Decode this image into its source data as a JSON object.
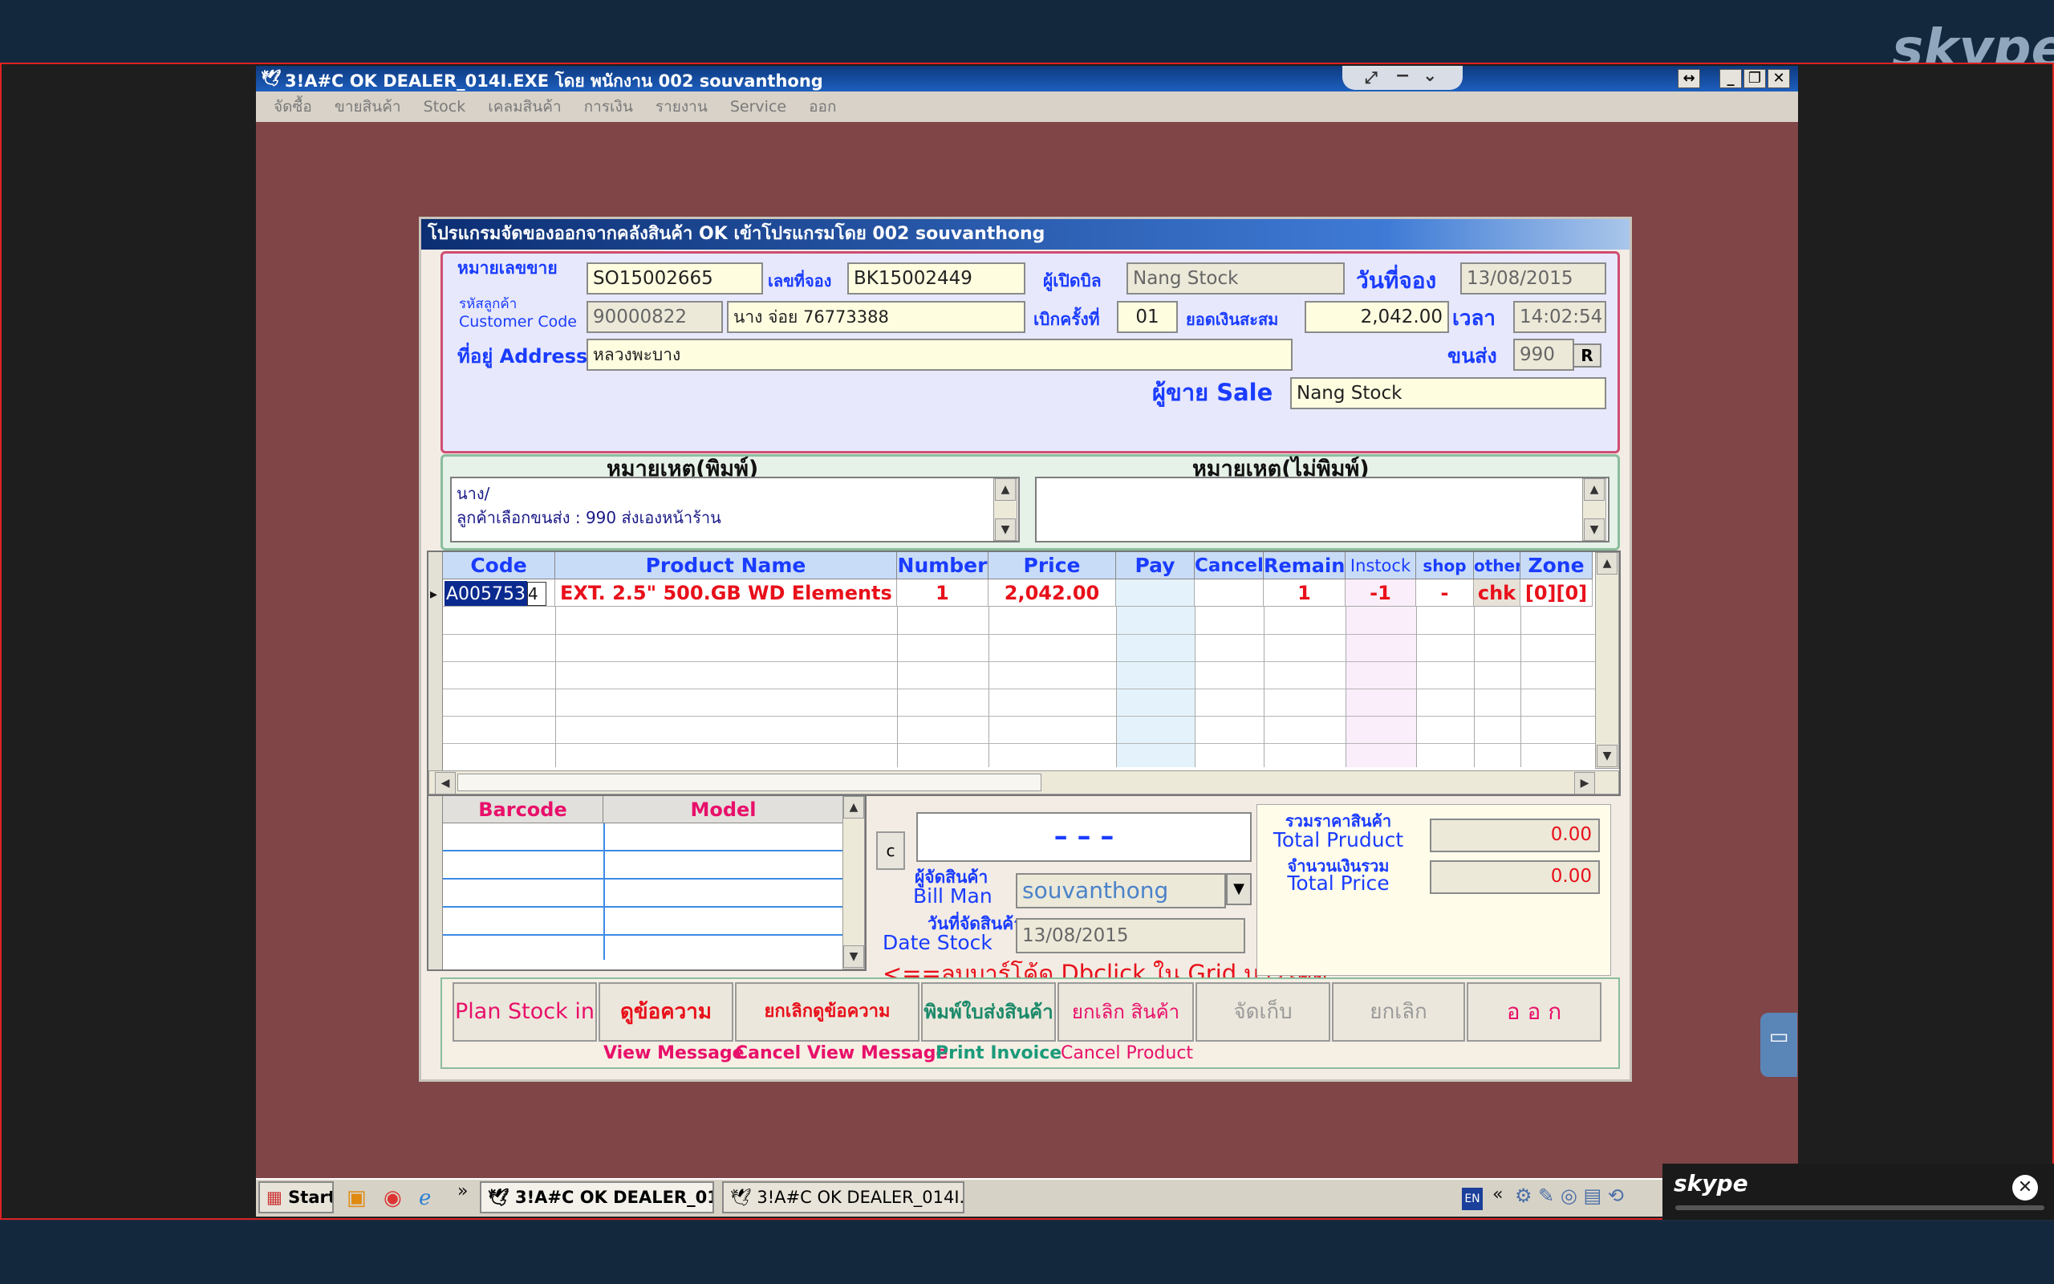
{
  "skype": {
    "logo": "skype",
    "mini_logo": "skype"
  },
  "window": {
    "title": "3!A#C OK DEALER_014I.EXE โดย พนักงาน 002 souvanthong",
    "menu": [
      "จัดซื้อ",
      "ขายสินค้า",
      "Stock",
      "เคลมสินค้า",
      "การเงิน",
      "รายงาน",
      "Service",
      "ออก"
    ]
  },
  "dialog": {
    "title": "โปรแกรมจัดของออกจากคลังสินค้า OK เข้าโปรแกรมโดย 002 souvanthong",
    "labels": {
      "sale_no": "หมายเลขขาย",
      "booking_no": "เลขที่จอง",
      "opener": "ผู้เปิดบิล",
      "booking_date": "วันที่จอง",
      "customer_code_th": "รหัสลูกค้า",
      "customer_code_en": "Customer Code",
      "bill_count": "เบิกครั้งที่",
      "balance": "ยอดเงินสะสม",
      "time": "เวลา",
      "address": "ที่อยู่ Address",
      "shipping": "ขนส่ง",
      "sale": "ผู้ขาย Sale"
    },
    "values": {
      "sale_no": "SO15002665",
      "booking_no": "BK15002449",
      "opener": "Nang Stock",
      "booking_date": "13/08/2015",
      "customer_code": "90000822",
      "customer_name": "นาง จ่อย 76773388",
      "bill_count": "01",
      "balance": "2,042.00",
      "time": "14:02:54",
      "address": "หลวงพะบาง",
      "shipping": "990",
      "shipping_btn": "R",
      "sale": "Nang Stock"
    }
  },
  "remarks": {
    "print_label": "หมายเหตุ(พิมพ์)",
    "noprint_label": "หมายเหตุ(ไม่พิมพ์)",
    "print_lines": [
      "นาง/",
      "ลูกค้าเลือกขนส่ง : 990 ส่งเองหน้าร้าน"
    ]
  },
  "grid": {
    "columns": [
      "Code",
      "Product Name",
      "Number",
      "Price",
      "Pay",
      "Cancel",
      "Remain",
      "Instock",
      "shop",
      "other",
      "Zone"
    ],
    "row": {
      "code": "A005753",
      "edit": "4",
      "product": "EXT. 2.5\" 500.GB WD Elements",
      "number": "1",
      "price": "2,042.00",
      "pay": "",
      "cancel": "",
      "remain": "1",
      "instock": "-1",
      "shop": "-",
      "other": "chk",
      "zone": "[0][0]"
    }
  },
  "barcode_grid": {
    "columns": [
      "Barcode",
      "Model"
    ]
  },
  "lower": {
    "c_btn": "c",
    "dashes": "–  –  –",
    "billman_th": "ผู้จัดสินค้า",
    "billman_en": "Bill Man",
    "billman_value": "souvanthong",
    "datestock_th": "วันที่จัดสินค้า",
    "datestock_en": "Date Stock",
    "datestock_value": "13/08/2015",
    "hint": "<==ลบบาร์โค้ด Dbclick ใน Grid  บาร์โค้ด",
    "total_product_th": "รวมราคาสินค้า",
    "total_product_en": "Total Pruduct",
    "total_product_value": "0.00",
    "total_price_th": "จำนวนเงินรวม",
    "total_price_en": "Total Price",
    "total_price_value": "0.00"
  },
  "buttons": {
    "plan_stock": "Plan Stock in",
    "view_msg": "ดูข้อความ",
    "cancel_view": "ยกเลิกดูข้อความ",
    "print_invoice": "พิมพ์ใบส่งสินค้า",
    "cancel_product": "ยกเลิก สินค้า",
    "store": "จัดเก็บ",
    "cancel": "ยกเลิก",
    "exit": "อ อ ก"
  },
  "button_subs": {
    "view_msg": "View Message",
    "cancel_view": "Cancel View Message",
    "print_invoice": "Print Invoice",
    "cancel_product": "Cancel Product"
  },
  "taskbar": {
    "start": "Start",
    "task1": "3!A#C OK DEALER_01...",
    "task2": "3!A#C OK DEALER_014I...",
    "lang": "EN"
  },
  "colors": {
    "accent_blue": "#1a3cff",
    "accent_red": "#e8101a",
    "desktop": "#7f4547",
    "skype_frame": "#d22222"
  }
}
